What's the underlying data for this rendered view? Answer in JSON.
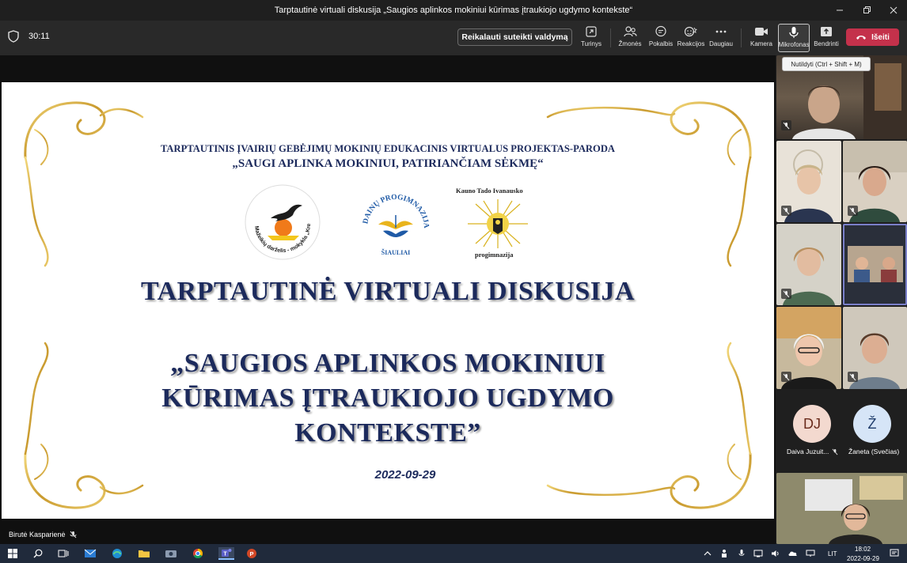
{
  "window": {
    "title": "Tarptautinė virtuali diskusija „Saugios aplinkos mokiniui kūrimas įtraukiojo ugdymo kontekste“"
  },
  "toolbar": {
    "timer": "30:11",
    "request_control_label": "Reikalauti suteikti valdymą",
    "items": {
      "content": "Turinys",
      "people": "Žmonės",
      "chat": "Pokalbis",
      "reactions": "Reakcijos",
      "more": "Daugiau",
      "camera": "Kamera",
      "microphone": "Mikrofonas",
      "share": "Bendrinti"
    },
    "leave_label": "Išeiti",
    "mute_tooltip": "Nutildyti (Ctrl + Shift + M)"
  },
  "slide": {
    "header_line1": "TARPTAUTINIS ĮVAIRIŲ GEBĖJIMŲ MOKINIŲ EDUKACINIS VIRTUALUS PROJEKTAS-PARODA",
    "header_line2": "„SAUGI APLINKA MOKINIUI, PATIRIANČIAM SĖKMĘ“",
    "logo1_ring_text": "Mažeikių darželis - mokykla „Kregždutė“",
    "logo2_ring_text": "DAINŲ PROGIMNAZIJA",
    "logo2_city": "ŠIAULIAI",
    "logo3_top": "Kauno Tado Ivanausko",
    "logo3_bottom": "progimnazija",
    "title": "TARPTAUTINĖ VIRTUALI DISKUSIJA",
    "subtitle_lines": [
      "„SAUGIOS APLINKOS MOKINIUI",
      "KŪRIMAS ĮTRAUKIOJO UGDYMO",
      "KONTEKSTE”"
    ],
    "date": "2022-09-29"
  },
  "presenter": {
    "name": "Birutė Kasparienė"
  },
  "gallery": {
    "participants": [
      {
        "initials": "DJ",
        "name": "Daiva Juzuit...",
        "color": "#f3d9cf",
        "text_color": "#6a2b1c"
      },
      {
        "initials": "Ž",
        "name": "Žaneta (Svečias)",
        "color": "#d6e5f7",
        "text_color": "#1e3b6a"
      }
    ]
  },
  "taskbar": {
    "lang": "LIT",
    "time": "18:02",
    "date": "2022-09-29"
  }
}
